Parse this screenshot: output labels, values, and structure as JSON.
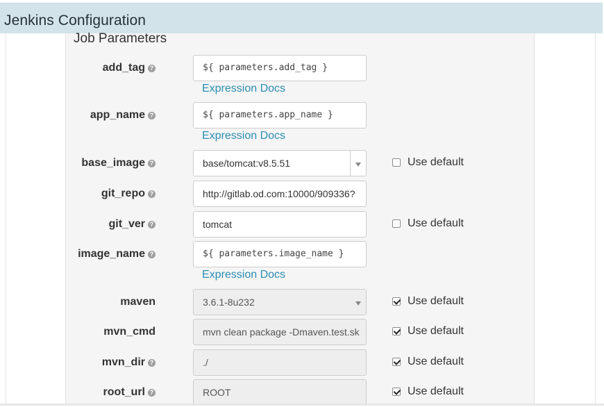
{
  "header": {
    "title": "Jenkins Configuration"
  },
  "section": {
    "title": "Job Parameters"
  },
  "help_glyph": "?",
  "rows": [
    {
      "label": "add_tag",
      "value": "${ parameters.add_tag }",
      "link": "Expression Docs"
    },
    {
      "label": "app_name",
      "value": "${ parameters.app_name }",
      "link": "Expression Docs"
    },
    {
      "label": "base_image",
      "value": "base/tomcat:v8.5.51",
      "use_default": "Use default",
      "use_default_checked": false
    },
    {
      "label": "git_repo",
      "value": "http://gitlab.od.com:10000/909336?"
    },
    {
      "label": "git_ver",
      "value": "tomcat",
      "use_default": "Use default",
      "use_default_checked": false
    },
    {
      "label": "image_name",
      "value": "${ parameters.image_name }",
      "link": "Expression Docs"
    },
    {
      "label": "maven",
      "value": "3.6.1-8u232",
      "use_default": "Use default",
      "use_default_checked": true
    },
    {
      "label": "mvn_cmd",
      "value": "mvn clean package -Dmaven.test.sk",
      "use_default": "Use default",
      "use_default_checked": true
    },
    {
      "label": "mvn_dir",
      "value": "./",
      "use_default": "Use default",
      "use_default_checked": true
    },
    {
      "label": "root_url",
      "value": "ROOT",
      "use_default": "Use default",
      "use_default_checked": true
    }
  ],
  "colors": {
    "header_bg": "#d3e3ea",
    "link": "#2a8db3",
    "panel_bg": "#f5f5f5"
  }
}
